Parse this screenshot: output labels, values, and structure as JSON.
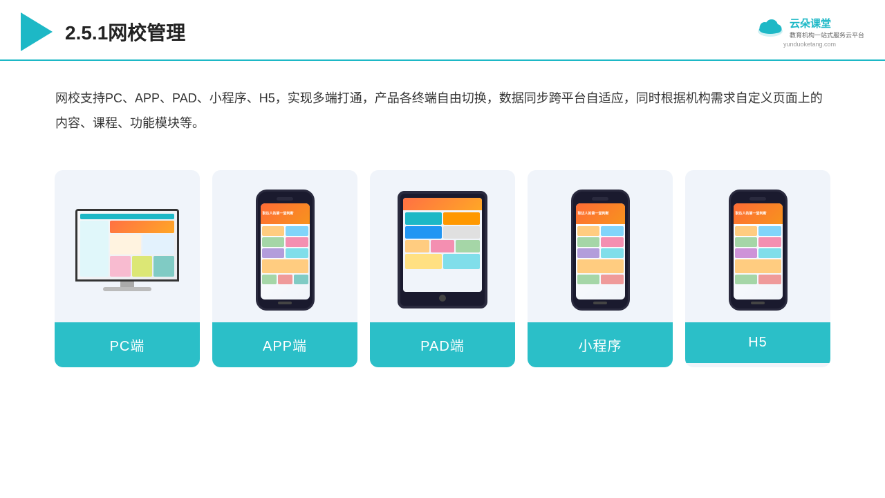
{
  "header": {
    "title": "2.5.1网校管理",
    "brand": {
      "name": "云朵课堂",
      "slogan": "教育机构一站式服务云平台",
      "url": "yunduoketang.com"
    }
  },
  "description": "网校支持PC、APP、PAD、小程序、H5，实现多端打通，产品各终端自由切换，数据同步跨平台自适应，同时根据机构需求自定义页面上的内容、课程、功能模块等。",
  "cards": [
    {
      "id": "pc",
      "label": "PC端"
    },
    {
      "id": "app",
      "label": "APP端"
    },
    {
      "id": "pad",
      "label": "PAD端"
    },
    {
      "id": "miniprogram",
      "label": "小程序"
    },
    {
      "id": "h5",
      "label": "H5"
    }
  ]
}
